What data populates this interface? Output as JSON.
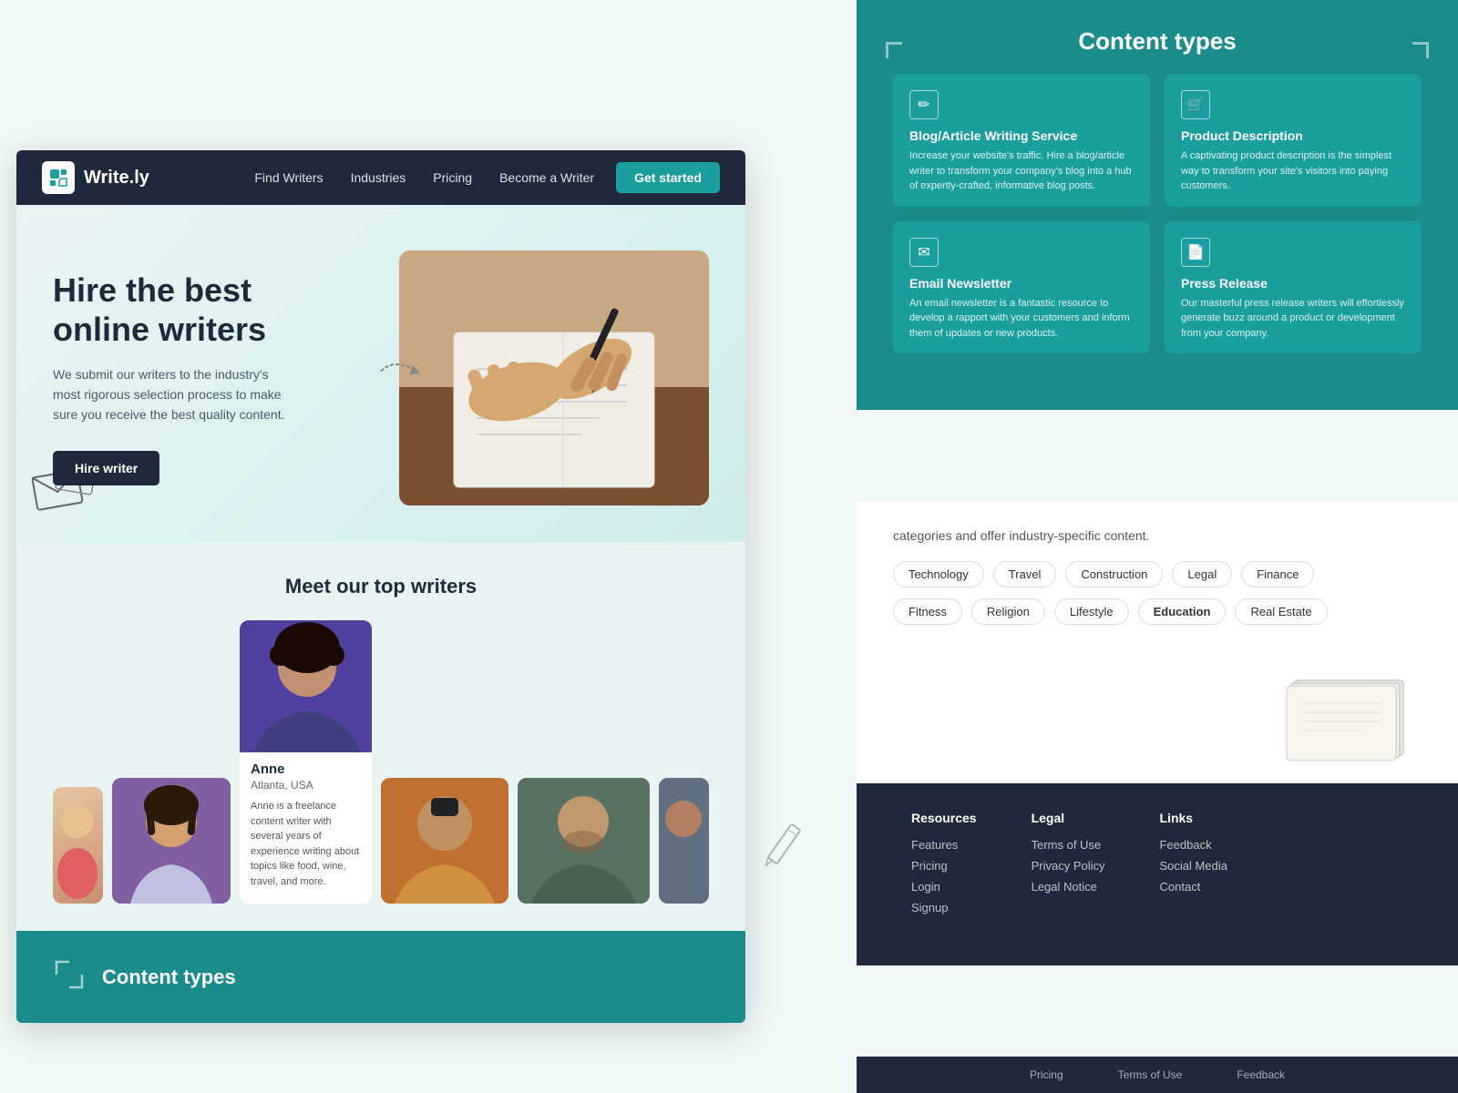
{
  "site": {
    "name": "Write.ly",
    "tagline": "Hire the best online writers",
    "description": "We submit our writers to the industry's most rigorous selection process to make sure you receive the best quality content."
  },
  "nav": {
    "logo": "Write.ly",
    "links": [
      "Find Writers",
      "Industries",
      "Pricing",
      "Become a Writer"
    ],
    "cta": "Get started"
  },
  "hero": {
    "title_line1": "Hire the best",
    "title_line2": "online writers",
    "description": "We submit our writers to the industry's most rigorous selection process to make sure you receive the best quality content.",
    "cta": "Hire writer"
  },
  "writers": {
    "section_title": "Meet our top writers",
    "featured": {
      "name": "Anne",
      "location": "Atlanta, USA",
      "bio": "Anne is a freelance content writer with several years of experience writing about topics like food, wine, travel, and more."
    }
  },
  "content_types": {
    "title": "Content types",
    "bottom_title": "Content types",
    "cards": [
      {
        "title": "Blog/Article Writing Service",
        "description": "Increase your website's traffic. Hire a blog/article writer to transform your company's blog into a hub of expertly-crafted, informative blog posts.",
        "icon": "✏"
      },
      {
        "title": "Product Description",
        "description": "A captivating product description is the simplest way to transform your site's visitors into paying customers.",
        "icon": "🛒"
      },
      {
        "title": "Email Newsletter",
        "description": "An email newsletter is a fantastic resource to develop a rapport with your customers and inform them of updates or new products.",
        "icon": "✉"
      },
      {
        "title": "Press Release",
        "description": "Our masterful press release writers will effortlessly generate buzz around a product or development from your company.",
        "icon": "📄"
      }
    ]
  },
  "industries": {
    "description": "categories and offer industry-specific content.",
    "tags_row1": [
      "Technology",
      "Travel",
      "Construction",
      "Legal",
      "Finance"
    ],
    "tags_row2": [
      "Fitness",
      "Religion",
      "Lifestyle",
      "Education",
      "Real Estate"
    ]
  },
  "footer": {
    "columns": [
      {
        "title": "Resources",
        "links": [
          "Features",
          "Pricing",
          "Login",
          "Signup"
        ]
      },
      {
        "title": "Legal",
        "links": [
          "Terms of Use",
          "Privacy Policy",
          "Legal Notice"
        ]
      },
      {
        "title": "Links",
        "links": [
          "Feedback",
          "Social Media",
          "Contact"
        ]
      }
    ],
    "bottom_links": [
      "Pricing",
      "Terms of Use",
      "Feedback"
    ]
  }
}
